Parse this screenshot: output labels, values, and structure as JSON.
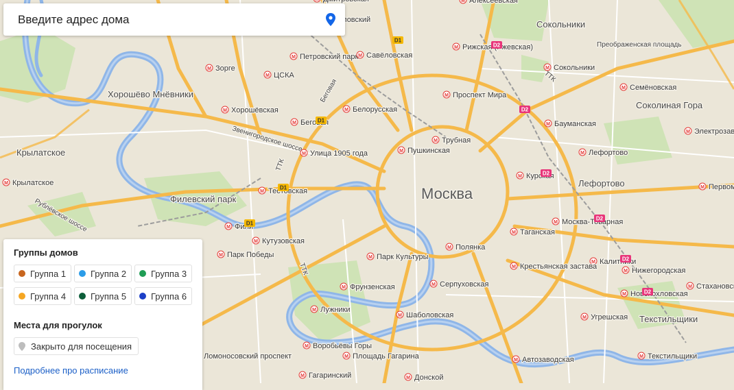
{
  "search": {
    "placeholder": "Введите адрес дома"
  },
  "map": {
    "city_label": "Москва",
    "districts": [
      "Хорошёво Мнёвники",
      "Крылатское",
      "Филевский парк",
      "Соколиная Гора",
      "Лефортово",
      "Текстильщики",
      "Сокольники",
      "Преображенская площадь",
      "Сокольники"
    ],
    "metro_stations": [
      "Дмитровская",
      "Савёловский",
      "Петровский парк",
      "Савёловская",
      "Зорге",
      "ЦСКА",
      "Хорошёвская",
      "Беговая",
      "Белорусская",
      "Улица 1905 года",
      "Пушкинская",
      "Трубная",
      "Проспект Мира",
      "Рижская (Ржевская)",
      "Сокольники",
      "Семёновская",
      "Электрозаводская",
      "Бауманская",
      "Лефортово",
      "Курская",
      "Крылатское",
      "Тестовская",
      "Фили",
      "Кутузовская",
      "Парк Победы",
      "Парк Культуры",
      "Полянка",
      "Таганская",
      "Москва-Товарная",
      "Калитники",
      "Нижегородская",
      "Новохохловская",
      "Стахановская",
      "Крестьянская застава",
      "Серпуховская",
      "Фрунзенская",
      "Шаболовская",
      "Лужники",
      "Воробьёвы Горы",
      "Площадь Гагарина",
      "Ломоносовский проспект",
      "Гагаринский",
      "Донской",
      "Автозаводская",
      "Угрешская",
      "Текстильщики",
      "Алексеевская",
      "Первомайская"
    ],
    "roads": [
      "Звенигородское шоссе",
      "Рублёвское шоссе",
      "Беговая",
      "ТТК",
      "ТТК",
      "ТТК"
    ],
    "rail_badges": [
      "D1",
      "D1",
      "D1",
      "D1",
      "D2",
      "D2",
      "D2",
      "D2",
      "D2",
      "D2"
    ]
  },
  "legend": {
    "groups_title": "Группы домов",
    "groups": [
      {
        "label": "Группа 1",
        "color": "#c8661f"
      },
      {
        "label": "Группа 2",
        "color": "#2b9ce8"
      },
      {
        "label": "Группа 3",
        "color": "#1f9d55"
      },
      {
        "label": "Группа 4",
        "color": "#f5a623"
      },
      {
        "label": "Группа 5",
        "color": "#0d5e3a"
      },
      {
        "label": "Группа 6",
        "color": "#1c3fc7"
      }
    ],
    "places_title": "Места для прогулок",
    "closed_label": "Закрыто для посещения",
    "closed_color": "#bdbdbd",
    "schedule_link": "Подробнее про расписание"
  },
  "colors": {
    "accent": "#1b5fc7",
    "pin": "#1366e8",
    "road_major": "#f5b94a",
    "water": "#8fb6e8",
    "park": "#cfe3b6",
    "metro": "#e53935"
  }
}
